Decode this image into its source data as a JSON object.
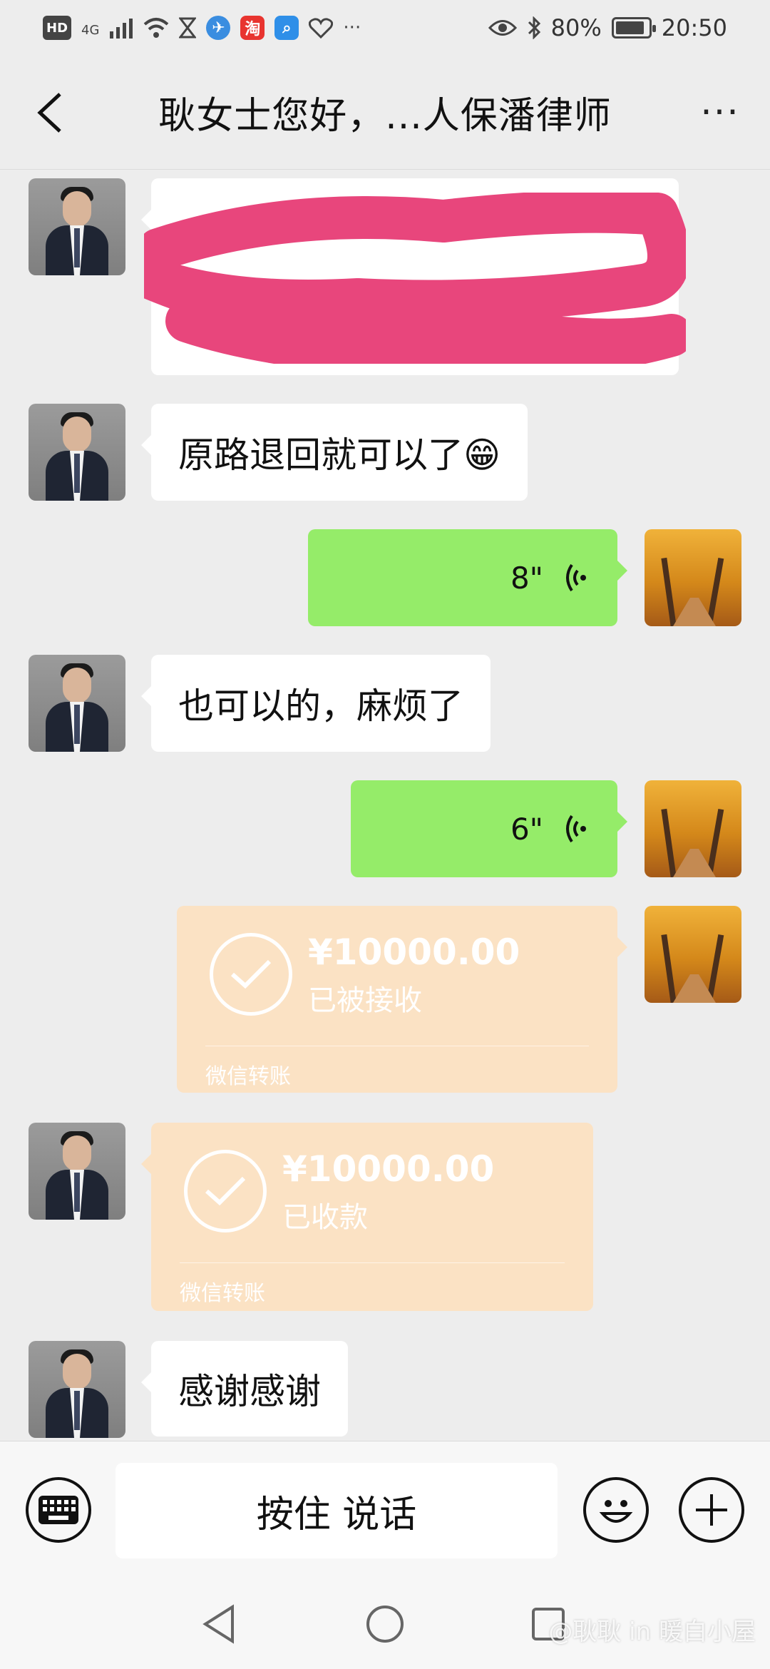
{
  "status_bar": {
    "network": "4G",
    "hd": "HD",
    "taobao": "淘",
    "more": "···",
    "battery": "80%",
    "time": "20:50"
  },
  "header": {
    "title": "耿女士您好，...人保潘律师",
    "more": "···"
  },
  "messages": [
    {
      "side": "left",
      "type": "redacted"
    },
    {
      "side": "left",
      "type": "text",
      "text": "原路退回就可以了😁"
    },
    {
      "side": "right",
      "type": "voice",
      "duration": "8\""
    },
    {
      "side": "left",
      "type": "text",
      "text": "也可以的，麻烦了"
    },
    {
      "side": "right",
      "type": "voice",
      "duration": "6\""
    },
    {
      "side": "right",
      "type": "transfer",
      "amount": "¥10000.00",
      "status": "已被接收",
      "label": "微信转账"
    },
    {
      "side": "left",
      "type": "transfer",
      "amount": "¥10000.00",
      "status": "已收款",
      "label": "微信转账"
    },
    {
      "side": "left",
      "type": "text",
      "text": "感谢感谢"
    }
  ],
  "input_bar": {
    "hold_to_talk": "按住 说话"
  },
  "watermark": "@耿耿 in 暖白小屋",
  "colors": {
    "sent_bubble": "#95ec69",
    "transfer_bubble": "#fbe2c4",
    "background": "#ededed",
    "redaction": "#e8467c"
  }
}
